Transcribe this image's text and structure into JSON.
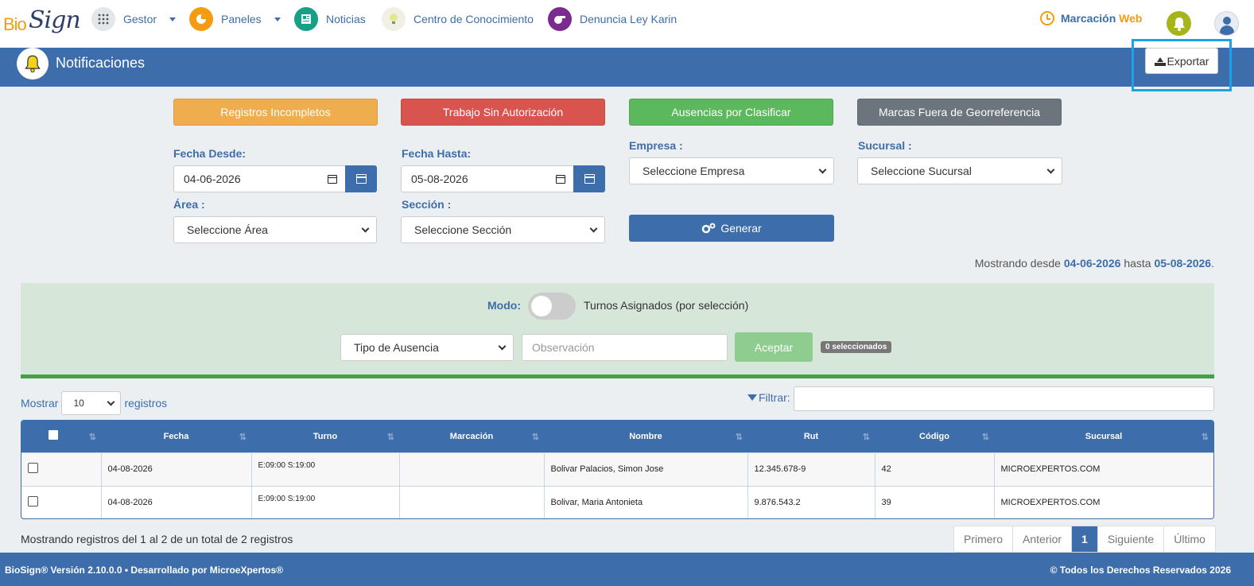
{
  "brand": {
    "bio": "Bio",
    "sign": "Sign"
  },
  "nav": {
    "gestor": "Gestor",
    "paneles": "Paneles",
    "noticias": "Noticias",
    "centro": "Centro de Conocimiento",
    "denuncia": "Denuncia Ley Karin",
    "marcacion": "Marcación",
    "marcacion_web": "Web"
  },
  "colors": {
    "primary": "#3d6daa",
    "warning": "#f0ad4e",
    "danger": "#d9534f",
    "success": "#5cb85c",
    "secondary": "#6c757d",
    "accent": "#f39c12"
  },
  "page": {
    "title": "Notificaciones",
    "export_label": "Exportar"
  },
  "filters": {
    "registros_incompletos": "Registros Incompletos",
    "trabajo_sin_autorizacion": "Trabajo Sin Autorización",
    "ausencias_por_clasificar": "Ausencias por Clasificar",
    "marcas_fuera": "Marcas Fuera de Georreferencia",
    "fecha_desde_label": "Fecha Desde:",
    "fecha_desde": "04-06-2026",
    "fecha_hasta_label": "Fecha Hasta:",
    "fecha_hasta": "05-08-2026",
    "empresa_label": "Empresa :",
    "empresa_value": "Seleccione Empresa",
    "sucursal_label": "Sucursal :",
    "sucursal_value": "Seleccione Sucursal",
    "area_label": "Área :",
    "area_value": "Seleccione Área",
    "seccion_label": "Sección :",
    "seccion_value": "Seleccione Sección",
    "generar": "Generar"
  },
  "range": {
    "prefix": "Mostrando desde",
    "from": "04-06-2026",
    "mid": "hasta",
    "to": "05-08-2026",
    "suffix": "."
  },
  "mode": {
    "label": "Modo:",
    "text": "Turnos Asignados (por selección)",
    "tipo_ausencia": "Tipo de Ausencia",
    "observacion_placeholder": "Observación",
    "aceptar": "Aceptar",
    "selected_badge": "0 seleccionados"
  },
  "table_controls": {
    "mostrar": "Mostrar",
    "page_length": "10",
    "registros": "registros",
    "filtrar": "Filtrar:"
  },
  "table": {
    "headers": [
      "Fecha",
      "Turno",
      "Marcación",
      "Nombre",
      "Rut",
      "Código",
      "Sucursal"
    ],
    "rows": [
      {
        "fecha": "04-08-2026",
        "turno": "E:09:00 S:19:00",
        "marcacion": "",
        "nombre": "Bolivar Palacios, Simon Jose",
        "rut": "12.345.678-9",
        "codigo": "42",
        "sucursal": "MICROEXPERTOS.COM"
      },
      {
        "fecha": "04-08-2026",
        "turno": "E:09:00 S:19:00",
        "marcacion": "",
        "nombre": "Bolivar, Maria Antonieta",
        "rut": "9.876.543.2",
        "codigo": "39",
        "sucursal": "MICROEXPERTOS.COM"
      }
    ]
  },
  "pagination": {
    "info": "Mostrando registros del 1 al 2 de un total de 2 registros",
    "first": "Primero",
    "prev": "Anterior",
    "current": "1",
    "next": "Siguiente",
    "last": "Último"
  },
  "footer": {
    "left": "BioSign® Versión 2.10.0.0 • Desarrollado por MicroeXpertos®",
    "right": "© Todos los Derechos Reservados 2026"
  }
}
